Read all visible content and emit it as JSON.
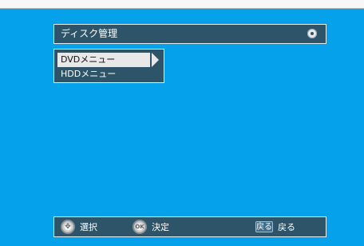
{
  "window": {
    "title": "ディスク管理",
    "title_icon": "disc-icon"
  },
  "menu": {
    "items": [
      {
        "label": "DVDメニュー",
        "selected": true
      },
      {
        "label": "HDDメニュー",
        "selected": false
      }
    ],
    "submenu_indicator": "arrow-right-icon"
  },
  "footer": {
    "select_label": "選択",
    "select_icon": "directional-pad-icon",
    "confirm_label": "決定",
    "confirm_icon": "ok-pad-icon",
    "back_key_text": "戻る",
    "back_label": "戻る"
  },
  "colors": {
    "background": "#05a1ea",
    "panel": "#2d5468",
    "highlight": "#e8e8e8"
  }
}
